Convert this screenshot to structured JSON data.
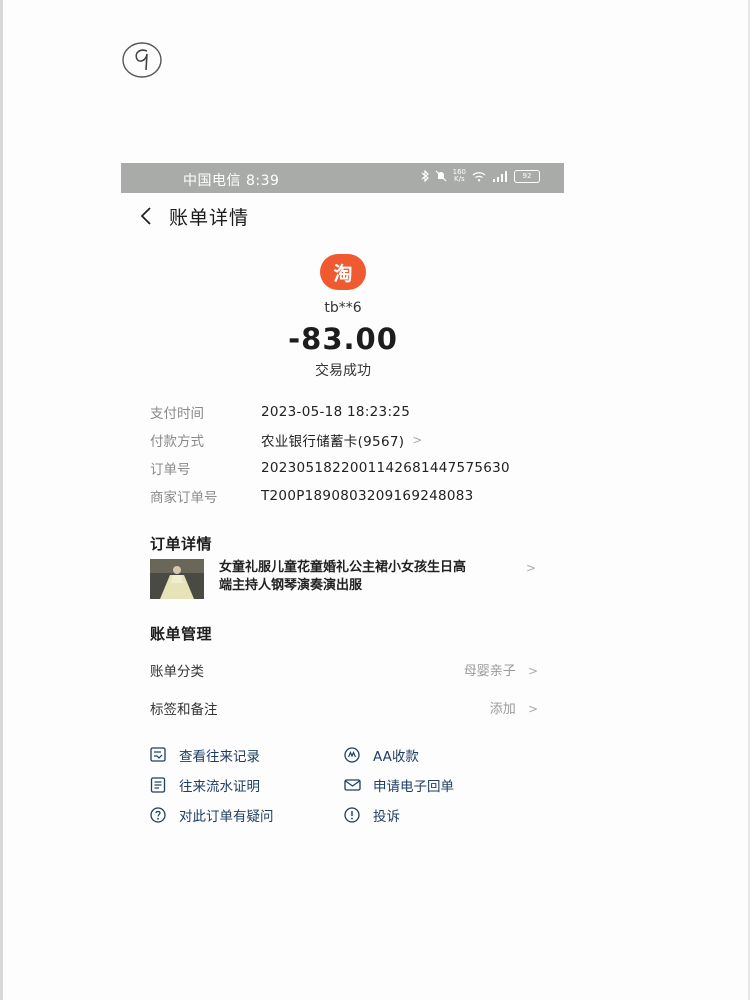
{
  "status_bar": {
    "carrier_time": "中国电信 8:39",
    "net_speed_top": "160",
    "net_speed_unit": "K/s",
    "battery": "92"
  },
  "header": {
    "title": "账单详情"
  },
  "merchant": {
    "logo_text": "淘",
    "name": "tb**6",
    "amount": "-83.00",
    "status": "交易成功"
  },
  "details": [
    {
      "label": "支付时间",
      "value": "2023-05-18 18:23:25"
    },
    {
      "label": "付款方式",
      "value": "农业银行储蓄卡(9567)"
    },
    {
      "label": "订单号",
      "value": "20230518220011426814475​75630"
    },
    {
      "label": "商家订单号",
      "value": "T200P1890803209169248083"
    }
  ],
  "order_section": {
    "title": "订单详情",
    "item_line1": "女童礼服儿童花童婚礼公主裙小女孩生日高",
    "item_line2": "端主持人钢琴演奏演出服"
  },
  "management": {
    "title": "账单管理",
    "category_label": "账单分类",
    "category_value": "母婴亲子",
    "tags_label": "标签和备注",
    "tags_value": "添加"
  },
  "actions": {
    "history": "查看往来记录",
    "aa": "AA收款",
    "statement": "往来流水证明",
    "receipt": "申请电子回单",
    "question": "对此订单有疑问",
    "complaint": "投诉"
  },
  "colors": {
    "logo": "#ef5a31",
    "action_text": "#1f3e63",
    "status_bar": "#a8aba8"
  },
  "handwritten": "9"
}
